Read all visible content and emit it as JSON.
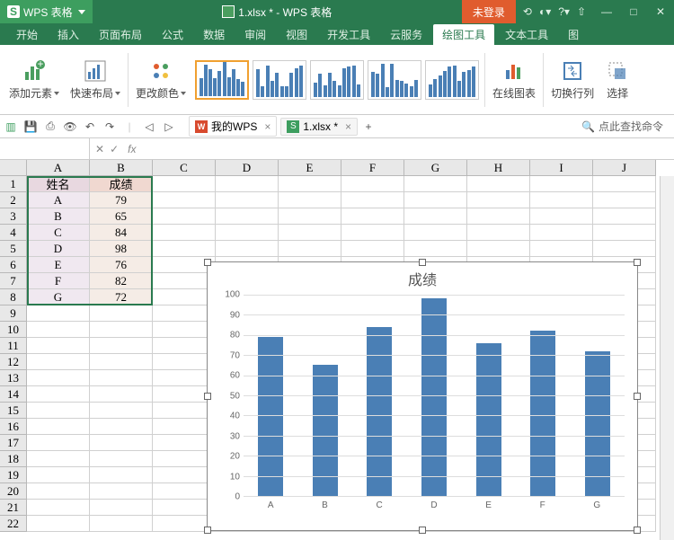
{
  "app": {
    "name": "WPS 表格",
    "doc_title": "1.xlsx * - WPS 表格",
    "login": "未登录"
  },
  "menu_tabs": [
    "开始",
    "插入",
    "页面布局",
    "公式",
    "数据",
    "审阅",
    "视图",
    "开发工具",
    "云服务",
    "绘图工具",
    "文本工具",
    "图"
  ],
  "menu_active": 9,
  "ribbon": {
    "add_elem": "添加元素",
    "quick_layout": "快速布局",
    "change_color": "更改颜色",
    "online_chart": "在线图表",
    "switch_rc": "切换行列",
    "select": "选择"
  },
  "doc_tabs": {
    "mywps": "我的WPS",
    "file": "1.xlsx *"
  },
  "search_cmd": "点此查找命令",
  "columns": [
    "A",
    "B",
    "C",
    "D",
    "E",
    "F",
    "G",
    "H",
    "I",
    "J"
  ],
  "sheet": {
    "headers": {
      "a": "姓名",
      "b": "成绩"
    },
    "rows": [
      {
        "name": "A",
        "score": "79"
      },
      {
        "name": "B",
        "score": "65"
      },
      {
        "name": "C",
        "score": "84"
      },
      {
        "name": "D",
        "score": "98"
      },
      {
        "name": "E",
        "score": "76"
      },
      {
        "name": "F",
        "score": "82"
      },
      {
        "name": "G",
        "score": "72"
      }
    ]
  },
  "chart_data": {
    "type": "bar",
    "title": "成绩",
    "categories": [
      "A",
      "B",
      "C",
      "D",
      "E",
      "F",
      "G"
    ],
    "values": [
      79,
      65,
      84,
      98,
      76,
      82,
      72
    ],
    "xlabel": "",
    "ylabel": "",
    "ylim": [
      0,
      100
    ],
    "yticks": [
      0,
      10,
      20,
      30,
      40,
      50,
      60,
      70,
      80,
      90,
      100
    ]
  }
}
